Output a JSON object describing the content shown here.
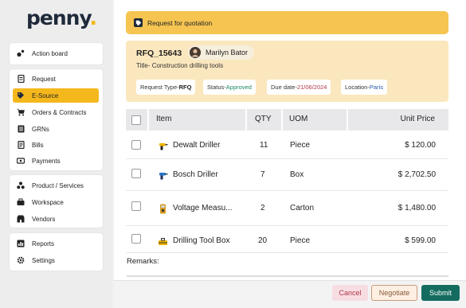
{
  "app": {
    "logo_text": "penny",
    "logo_dot": "."
  },
  "sidebar": {
    "items": [
      {
        "label": "Action board",
        "icon": "action-board-icon"
      },
      {
        "label": "Request",
        "icon": "document-icon"
      },
      {
        "label": "E-Source",
        "icon": "tag-icon",
        "active": true
      },
      {
        "label": "Orders & Contracts",
        "icon": "cart-icon"
      },
      {
        "label": "GRNs",
        "icon": "list-icon"
      },
      {
        "label": "Bills",
        "icon": "bill-icon"
      },
      {
        "label": "Payments",
        "icon": "payment-icon"
      },
      {
        "label": "Product / Services",
        "icon": "boxes-icon"
      },
      {
        "label": "Workspace",
        "icon": "workspace-icon"
      },
      {
        "label": "Vendors",
        "icon": "vendors-icon"
      },
      {
        "label": "Reports",
        "icon": "reports-icon"
      },
      {
        "label": "Settings",
        "icon": "gear-icon"
      }
    ]
  },
  "header": {
    "title": "Request for quotation"
  },
  "rfq": {
    "id": "RFQ_15643",
    "user": "Marilyn Bator",
    "title": "Title- Construction drilling tools",
    "tags": [
      {
        "label": "Request Type- ",
        "value": "RFQ"
      },
      {
        "label": "Status- ",
        "value": "Approved"
      },
      {
        "label": "Due date- ",
        "value": "21/06/2024"
      },
      {
        "label": "Location- ",
        "value": "Paris"
      }
    ]
  },
  "table": {
    "columns": [
      "Item",
      "QTY",
      "UOM",
      "Unit Price"
    ],
    "rows": [
      {
        "item": "Dewalt Driller",
        "qty": "11",
        "uom": "Piece",
        "price": "$ 120.00",
        "icon": "drill-icon"
      },
      {
        "item": "Bosch Driller",
        "qty": "7",
        "uom": "Box",
        "price": "$ 2,702.50",
        "icon": "drill-icon"
      },
      {
        "item": "Voltage Measu...",
        "qty": "2",
        "uom": "Carton",
        "price": "$ 1,480.00",
        "icon": "meter-icon"
      },
      {
        "item": "Drilling Tool Box",
        "qty": "20",
        "uom": "Piece",
        "price": "$ 599.00",
        "icon": "toolbox-icon"
      }
    ]
  },
  "remarks_label": "Remarks:",
  "footer": {
    "cancel": "Cancel",
    "negotiate": "Negotiate",
    "submit": "Submit"
  },
  "colors": {
    "accent": "#f5b81c",
    "header": "#f5c451",
    "submit": "#146c60",
    "approved": "#1e8a5e"
  }
}
